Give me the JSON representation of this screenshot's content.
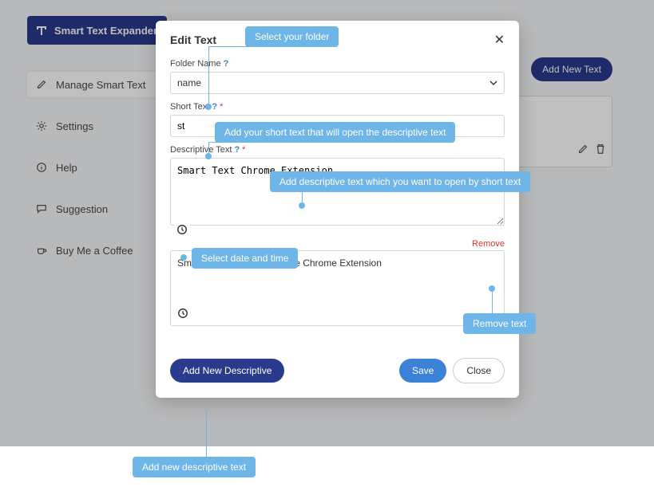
{
  "brand": {
    "title": "Smart Text Expander"
  },
  "sidebar": {
    "items": [
      {
        "label": "Manage Smart Text"
      },
      {
        "label": "Settings"
      },
      {
        "label": "Help"
      },
      {
        "label": "Suggestion"
      },
      {
        "label": "Buy Me a Coffee"
      }
    ]
  },
  "header": {
    "add_button": "Add New Text"
  },
  "modal": {
    "title": "Edit Text",
    "folder_label": "Folder Name",
    "folder_value": "name",
    "short_label": "Short Text",
    "short_value": "st",
    "desc_label": "Descriptive Text",
    "desc_value": "Smart Text Chrome Extension",
    "remove_label": "Remove",
    "desc2_value": "Smart Text Expander Google Chrome Extension",
    "add_desc_button": "Add New Descriptive",
    "save_button": "Save",
    "close_button": "Close"
  },
  "callouts": {
    "folder": "Select your folder",
    "short": "Add your short text that will open the descriptive text",
    "desc": "Add descriptive text which you want to open by short text",
    "datetime": "Select date and time",
    "remove": "Remove text",
    "adddesc": "Add new descriptive text"
  }
}
